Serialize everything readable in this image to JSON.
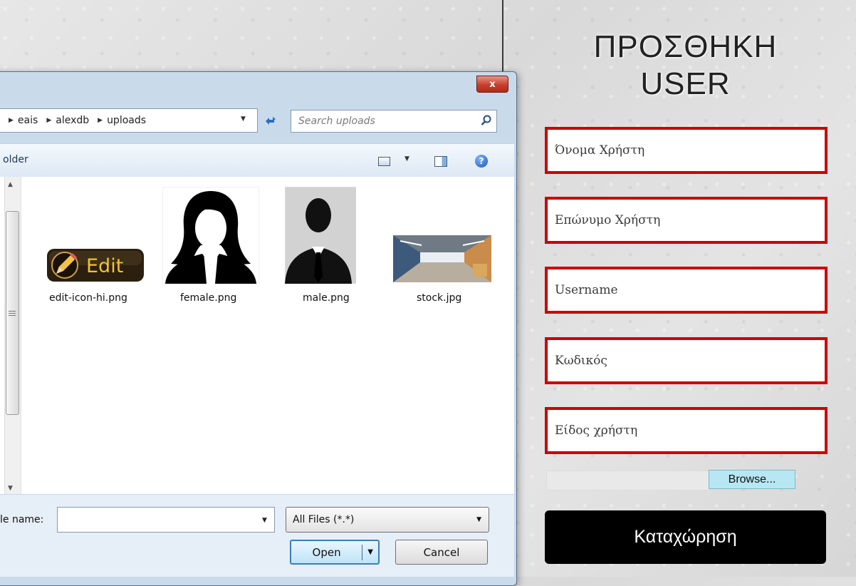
{
  "form": {
    "title_line1": "ΠΡΟΣΘΗΚΗ",
    "title_line2": "USER",
    "fields": [
      {
        "placeholder": "Όνομα Χρήστη"
      },
      {
        "placeholder": "Επώνυμο Χρήστη"
      },
      {
        "placeholder": "Username"
      },
      {
        "placeholder": "Κωδικός"
      },
      {
        "placeholder": "Είδος χρήστη"
      }
    ],
    "browse_label": "Browse...",
    "submit_label": "Καταχώρηση",
    "colors": {
      "field_border": "#cc0000",
      "submit_bg": "#000000",
      "browse_bg": "#b6e7f3"
    }
  },
  "dialog": {
    "close_label": "x",
    "breadcrumb": [
      "eais",
      "alexdb",
      "uploads"
    ],
    "search_placeholder": "Search uploads",
    "toolbar_label": "older",
    "help_label": "?",
    "files": [
      {
        "name": "edit-icon-hi.png",
        "thumb_text": "Edit"
      },
      {
        "name": "female.png"
      },
      {
        "name": "male.png"
      },
      {
        "name": "stock.jpg"
      }
    ],
    "filename_label": "le name:",
    "filename_value": "",
    "filter_value": "All Files (*.*)",
    "open_label": "Open",
    "cancel_label": "Cancel"
  }
}
